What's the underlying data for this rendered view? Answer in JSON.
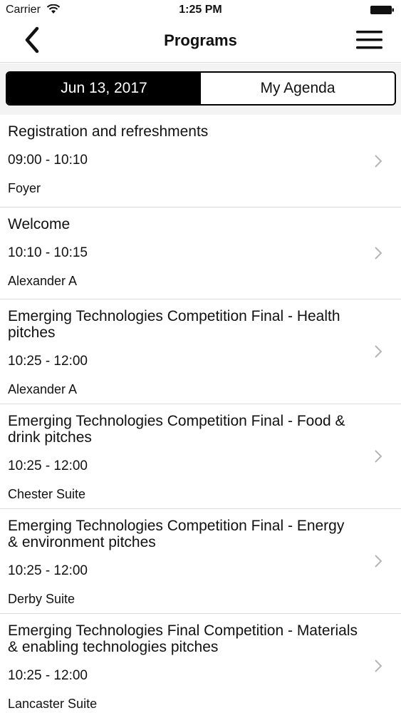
{
  "status_bar": {
    "carrier": "Carrier",
    "time": "1:25 PM",
    "wifi_icon": "wifi-icon",
    "battery_icon": "battery-icon"
  },
  "nav": {
    "title": "Programs",
    "back_icon": "back-chevron-icon",
    "menu_icon": "hamburger-menu-icon"
  },
  "tabs": {
    "date_label": "Jun 13, 2017",
    "agenda_label": "My Agenda",
    "active": "date"
  },
  "sessions": [
    {
      "title": "Registration and refreshments",
      "time": "09:00 - 10:10",
      "location": "Foyer"
    },
    {
      "title": "Welcome",
      "time": "10:10 - 10:15",
      "location": "Alexander A"
    },
    {
      "title": "Emerging Technologies Competition Final - Health pitches",
      "time": "10:25 - 12:00",
      "location": "Alexander A"
    },
    {
      "title": "Emerging Technologies Competition Final - Food & drink pitches",
      "time": "10:25 - 12:00",
      "location": "Chester Suite"
    },
    {
      "title": "Emerging Technologies Competition Final - Energy & environment pitches",
      "time": "10:25 - 12:00",
      "location": "Derby Suite"
    },
    {
      "title": "Emerging Technologies Final Competition - Materials & enabling technologies pitches",
      "time": "10:25 - 12:00",
      "location": "Lancaster Suite"
    }
  ],
  "colors": {
    "accent": "#000000",
    "separator": "#dcdcdc",
    "chevron": "#b5b5b5"
  }
}
